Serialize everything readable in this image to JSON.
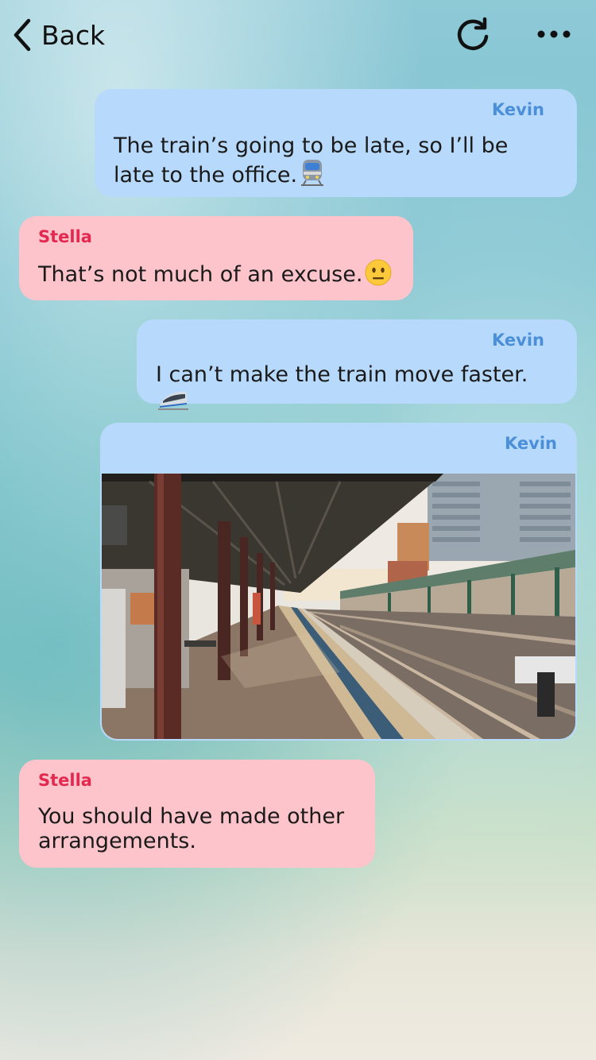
{
  "header": {
    "back_label": "Back",
    "refresh_icon": "refresh-icon",
    "more_icon": "more-dots-icon"
  },
  "messages": [
    {
      "sender": "Kevin",
      "side": "right",
      "text": "The train’s going to be late, so I’ll be late to the office.",
      "emoji": "train-emoji"
    },
    {
      "sender": "Stella",
      "side": "left",
      "text": "That’s not much of an excuse.",
      "emoji": "neutral-face-emoji"
    },
    {
      "sender": "Kevin",
      "side": "right",
      "text": "I can’t make the train move faster.",
      "emoji": "bullet-train-emoji"
    },
    {
      "sender": "Kevin",
      "side": "right",
      "image": "train-station-platform-photo"
    },
    {
      "sender": "Stella",
      "side": "left",
      "text": "You should have made other arrangements."
    }
  ],
  "colors": {
    "kevin_bubble": "#b7dafc",
    "stella_bubble": "#fec4cb",
    "kevin_name": "#4b8fd9",
    "stella_name": "#e3294f"
  }
}
